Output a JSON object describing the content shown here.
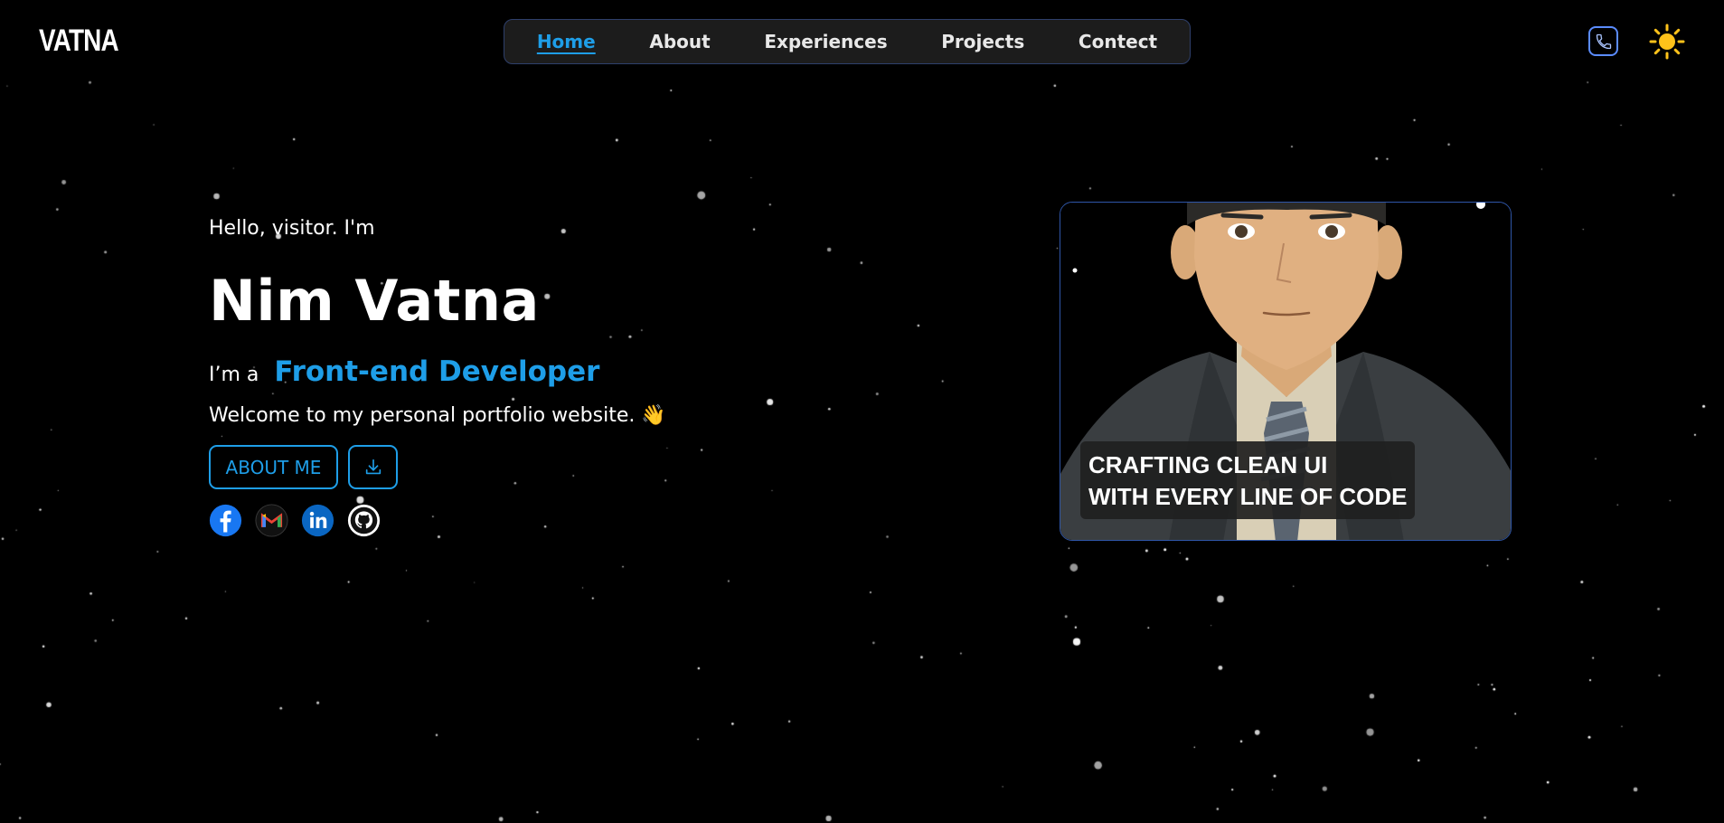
{
  "header": {
    "logo": "VATNA",
    "nav": [
      {
        "label": "Home",
        "active": true
      },
      {
        "label": "About",
        "active": false
      },
      {
        "label": "Experiences",
        "active": false
      },
      {
        "label": "Projects",
        "active": false
      },
      {
        "label": "Contect",
        "active": false
      }
    ],
    "icons": [
      "phone-icon",
      "sun-icon"
    ]
  },
  "hero": {
    "greeting": "Hello, visitor. I'm",
    "name": "Nim Vatna",
    "role_prefix": "I’m a",
    "role": "Front-end Developer",
    "welcome": "Welcome to my personal portfolio website. 👋",
    "about_button": "ABOUT ME",
    "download_icon": "download-icon",
    "socials": [
      "facebook-icon",
      "gmail-icon",
      "linkedin-icon",
      "github-icon"
    ]
  },
  "card": {
    "caption_line1": "CRAFTING CLEAN UI",
    "caption_line2": "WITH EVERY LINE OF CODE"
  },
  "colors": {
    "accent": "#1e9ee8",
    "background": "#000000",
    "nav_bg": "#1c1c1c",
    "sun": "#ffc21a",
    "phone": "#5b8cff"
  }
}
